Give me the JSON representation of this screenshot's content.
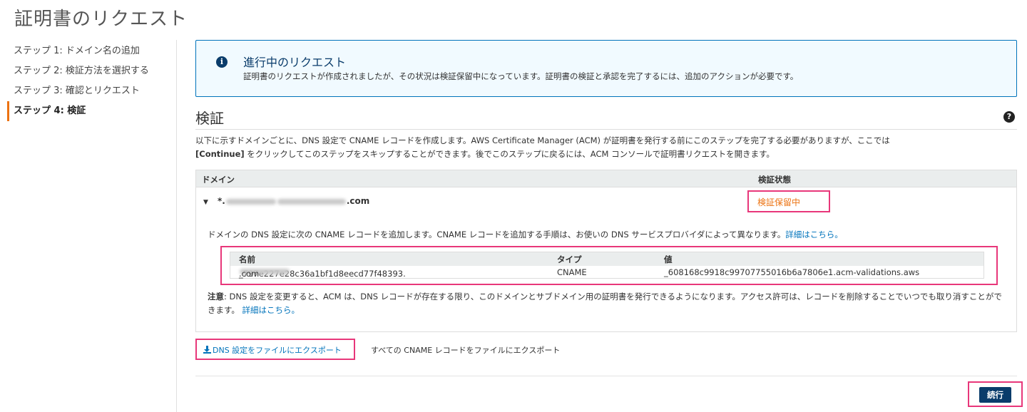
{
  "page": {
    "title": "証明書のリクエスト"
  },
  "steps": [
    {
      "label": "ステップ 1: ドメイン名の追加"
    },
    {
      "label": "ステップ 2: 検証方法を選択する"
    },
    {
      "label": "ステップ 3: 確認とリクエスト"
    },
    {
      "label": "ステップ 4: 検証",
      "active": true
    }
  ],
  "info": {
    "title": "進行中のリクエスト",
    "message": "証明書のリクエストが作成されましたが、その状況は検証保留中になっています。証明書の検証と承認を完了するには、追加のアクションが必要です。"
  },
  "validation": {
    "title": "検証",
    "desc_1": "以下に示すドメインごとに、DNS 設定で CNAME レコードを作成します。AWS Certificate Manager (ACM) が証明書を発行する前にこのステップを完了する必要がありますが、ここでは",
    "desc_continue": "[Continue]",
    "desc_2": " をクリックしてこのステップをスキップすることができます。後でこのステップに戻るには、ACM コンソールで証明書リクエストを開きます。"
  },
  "domain_table": {
    "headers": {
      "domain": "ドメイン",
      "status": "検証状態"
    },
    "domain_prefix": "*.",
    "domain_suffix": ".com",
    "status": "検証保留中",
    "instructions": "ドメインの DNS 設定に次の CNAME レコードを追加します。CNAME レコードを追加する手順は、お使いの DNS サービスプロバイダによって異なります。",
    "details_link": "詳細はこちら。"
  },
  "cname": {
    "headers": {
      "name": "名前",
      "type": "タイプ",
      "value": "値"
    },
    "name_prefix": "_797e227e28c36a1bf1d8eecd77f48393.",
    "name_suffix": ".com",
    "type": "CNAME",
    "value": "_608168c9918c99707755016b6a7806e1.acm-validations.aws"
  },
  "note": {
    "label": "注意",
    "text": ": DNS 設定を変更すると、ACM は、DNS レコードが存在する限り、このドメインとサブドメイン用の証明書を発行できるようになります。アクセス許可は、レコードを削除することでいつでも取り消すことができます。",
    "link": "詳細はこちら。"
  },
  "export": {
    "button": "DNS 設定をファイルにエクスポート",
    "description": "すべての CNAME レコードをファイルにエクスポート",
    "icon": "download-icon"
  },
  "actions": {
    "continue": "続行"
  },
  "colors": {
    "accent_link": "#0073bb",
    "primary_button": "#0a3c6b",
    "pending_status": "#ec7211",
    "highlight_box": "#e8377a",
    "info_bg": "#f1faff"
  }
}
